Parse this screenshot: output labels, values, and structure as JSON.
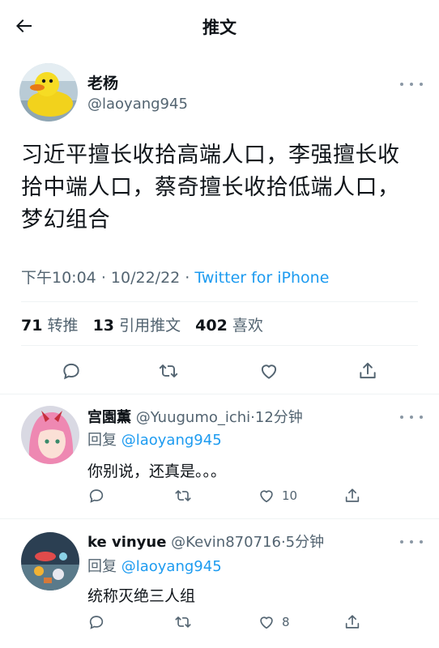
{
  "header": {
    "title": "推文"
  },
  "tweet": {
    "author_name": "老杨",
    "author_handle": "@laoyang945",
    "text_lines": [
      "习近平擅长收拾高端人口，李强擅长收",
      "拾中端人口，蔡奇擅长收拾低端人口，",
      "梦幻组合"
    ],
    "time": "下午10:04",
    "date": "10/22/22",
    "sep": "·",
    "source": "Twitter for iPhone",
    "retweets_count": "71",
    "retweets_label": "转推",
    "quotes_count": "13",
    "quotes_label": "引用推文",
    "likes_count": "402",
    "likes_label": "喜欢"
  },
  "replies": [
    {
      "name": "宫園薫",
      "handle": "@Yuugumo_ichi",
      "sep": "·",
      "time": "12分钟",
      "reply_prefix": "回复",
      "reply_to": "@laoyang945",
      "text": "你别说，还真是。。。",
      "like_count": "10"
    },
    {
      "name": "ke vinyue",
      "handle": "@Kevin870716",
      "sep": "·",
      "time": "5分钟",
      "reply_prefix": "回复",
      "reply_to": "@laoyang945",
      "text": "统称灭绝三人组",
      "like_count": "8"
    }
  ],
  "colors": {
    "accent": "#1d9bf0",
    "secondary": "#536471",
    "text": "#0f1419"
  },
  "icons": [
    "back-arrow-icon",
    "more-icon",
    "reply-icon",
    "retweet-icon",
    "like-icon",
    "share-icon"
  ]
}
